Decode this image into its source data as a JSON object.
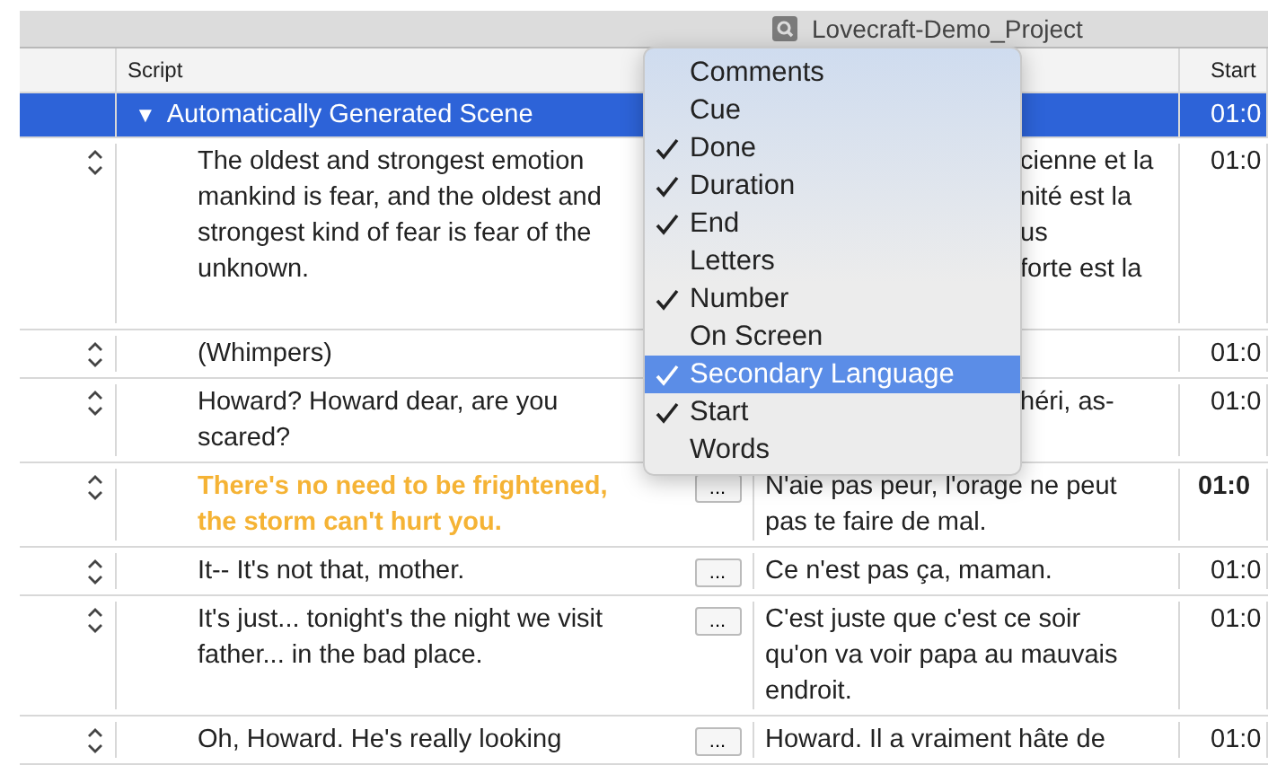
{
  "window": {
    "title": "Lovecraft-Demo_Project"
  },
  "table": {
    "columns": [
      "Script",
      "Start"
    ],
    "rows": [
      {
        "kind": "scene",
        "selected": true,
        "toggle": "▼",
        "script": [
          "Automatically Generated Scene"
        ],
        "start": "01:0"
      },
      {
        "kind": "line",
        "selected": false,
        "current": false,
        "partly_hidden": true,
        "script": [
          "The oldest and strongest emotion",
          "mankind is fear, and the oldest and",
          "strongest kind of fear is fear of the",
          "unknown."
        ],
        "secondary": [
          "cienne et la",
          "nité est la",
          "us",
          "forte est la"
        ],
        "start": "01:0"
      },
      {
        "kind": "line",
        "selected": false,
        "current": false,
        "script": [
          "(Whimpers)"
        ],
        "start": "01:0"
      },
      {
        "kind": "line",
        "selected": false,
        "current": false,
        "partly_hidden": true,
        "script": [
          "Howard? Howard dear, are you",
          "scared?"
        ],
        "secondary": [
          "héri, as-"
        ],
        "start": "01:0"
      },
      {
        "kind": "line",
        "selected": false,
        "current": true,
        "partly_hidden": false,
        "script": [
          "There's no need to be frightened,",
          "the storm can't hurt you."
        ],
        "button": "...",
        "secondary": [
          "N'aie pas peur, l'orage ne peut",
          "pas te faire de mal."
        ],
        "start": "01:0"
      },
      {
        "kind": "line",
        "selected": false,
        "current": false,
        "partly_hidden": false,
        "script": [
          "It-- It's not that, mother."
        ],
        "button": "...",
        "secondary": [
          "Ce n'est pas ça, maman."
        ],
        "start": "01:0"
      },
      {
        "kind": "line",
        "selected": false,
        "current": false,
        "partly_hidden": false,
        "script": [
          "It's just... tonight's the night we visit",
          "father... in the bad place."
        ],
        "button": "...",
        "secondary": [
          "C'est juste que c'est ce soir",
          "qu'on va voir papa au mauvais",
          "endroit."
        ],
        "start": "01:0"
      },
      {
        "kind": "line",
        "selected": false,
        "current": false,
        "partly_hidden": false,
        "script": [
          "Oh, Howard. He's really looking"
        ],
        "button": "...",
        "secondary": [
          "Howard. Il a vraiment hâte de"
        ],
        "start": "01:0"
      }
    ]
  },
  "column_menu": {
    "items": [
      {
        "label": "Comments",
        "checked": false,
        "selected": false
      },
      {
        "label": "Cue",
        "checked": false,
        "selected": false
      },
      {
        "label": "Done",
        "checked": true,
        "selected": false
      },
      {
        "label": "Duration",
        "checked": true,
        "selected": false
      },
      {
        "label": "End",
        "checked": true,
        "selected": false
      },
      {
        "label": "Letters",
        "checked": false,
        "selected": false
      },
      {
        "label": "Number",
        "checked": true,
        "selected": false
      },
      {
        "label": "On Screen",
        "checked": false,
        "selected": false
      },
      {
        "label": "Secondary Language",
        "checked": true,
        "selected": true
      },
      {
        "label": "Start",
        "checked": true,
        "selected": false
      },
      {
        "label": "Words",
        "checked": false,
        "selected": false
      }
    ]
  }
}
